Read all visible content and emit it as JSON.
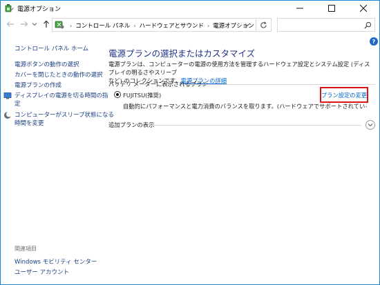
{
  "window": {
    "title": "電源オプション",
    "controls": {
      "minimize": "minimize-icon",
      "maximize": "maximize-icon",
      "close": "close-icon"
    }
  },
  "address": {
    "breadcrumbs": [
      "コントロール パネル",
      "ハードウェアとサウンド",
      "電源オプション"
    ],
    "search_placeholder": ""
  },
  "sidebar": {
    "home": "コントロール パネル ホーム",
    "items": [
      {
        "label": "電源ボタンの動作の選択",
        "icon": null
      },
      {
        "label": "カバーを閉じたときの動作の選択",
        "icon": null
      },
      {
        "label": "電源プランの作成",
        "icon": null
      },
      {
        "label_line1": "ディスプレイの電源を切る時間の指",
        "label_line2": "定",
        "icon": "monitor-icon"
      },
      {
        "label_line1": "コンピューターがスリープ状態になる",
        "label_line2": "時間を変更",
        "icon": "moon-icon"
      }
    ],
    "see_also_header": "関連項目",
    "see_also": [
      "Windows モビリティ センター",
      "ユーザー アカウント"
    ]
  },
  "main": {
    "title": "電源プランの選択またはカスタマイズ",
    "description_line1": "電源プランは、コンピューターの電源の使用方法を管理するハードウェア設定とシステム設定 (ディスプレイの明るさやスリープ",
    "description_line2": "など) のコレクションです。",
    "description_link": "電源プランの詳細",
    "battery_section_label": "バッテリ メーターに表示されるプラン",
    "plan": {
      "name": "FUJITSU(推奨)",
      "description": "自動的にパフォーマンスと電力消費のバランスを取ります。(ハードウェアでサポートされている場合)",
      "change_link": "プラン設定の変更",
      "selected": true
    },
    "additional_plans_label": "追加プランの表示"
  },
  "colors": {
    "accent": "#1883d7",
    "link": "#0066cc",
    "title": "#1e3287",
    "highlight_border": "#d9141b"
  }
}
